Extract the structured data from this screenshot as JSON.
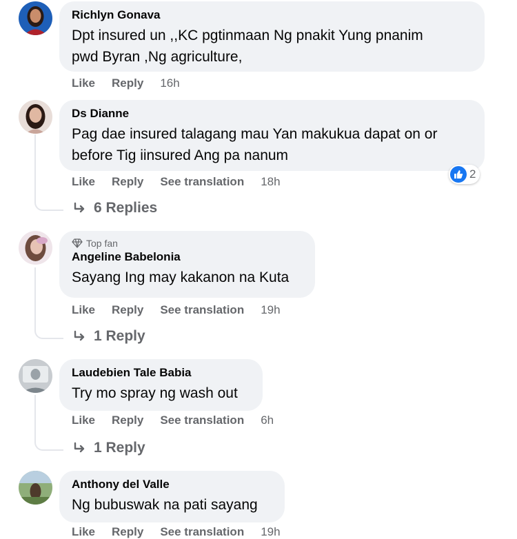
{
  "comments": [
    {
      "name": "Richlyn Gonava",
      "text_lines": [
        "Dpt insured un ,,KC pgtinmaan Ng pnakit Yung pnanim",
        "pwd Byran ,Ng agriculture,"
      ],
      "actions": {
        "like": "Like",
        "reply": "Reply"
      },
      "time": "16h"
    },
    {
      "name": "Ds Dianne",
      "text_lines": [
        "Pag dae insured talagang mau Yan makukua dapat on or",
        "before Tig iinsured Ang pa nanum"
      ],
      "actions": {
        "like": "Like",
        "reply": "Reply",
        "translate": "See translation"
      },
      "time": "18h",
      "reaction_count": "2",
      "replies_label": "6 Replies"
    },
    {
      "badge": "Top fan",
      "name": "Angeline Babelonia",
      "text_lines": [
        "Sayang Ing may kakanon na Kuta"
      ],
      "actions": {
        "like": "Like",
        "reply": "Reply",
        "translate": "See translation"
      },
      "time": "19h",
      "replies_label": "1 Reply"
    },
    {
      "name": "Laudebien Tale Babia",
      "text_lines": [
        "Try mo spray ng wash out"
      ],
      "actions": {
        "like": "Like",
        "reply": "Reply",
        "translate": "See translation"
      },
      "time": "6h",
      "replies_label": "1 Reply"
    },
    {
      "name": "Anthony del Valle",
      "text_lines": [
        "Ng bubuswak na pati sayang"
      ],
      "actions": {
        "like": "Like",
        "reply": "Reply",
        "translate": "See translation"
      },
      "time": "19h"
    }
  ],
  "colors": {
    "bubble": "#f0f2f5",
    "meta": "#65676b",
    "like_blue": "#1877f2"
  }
}
